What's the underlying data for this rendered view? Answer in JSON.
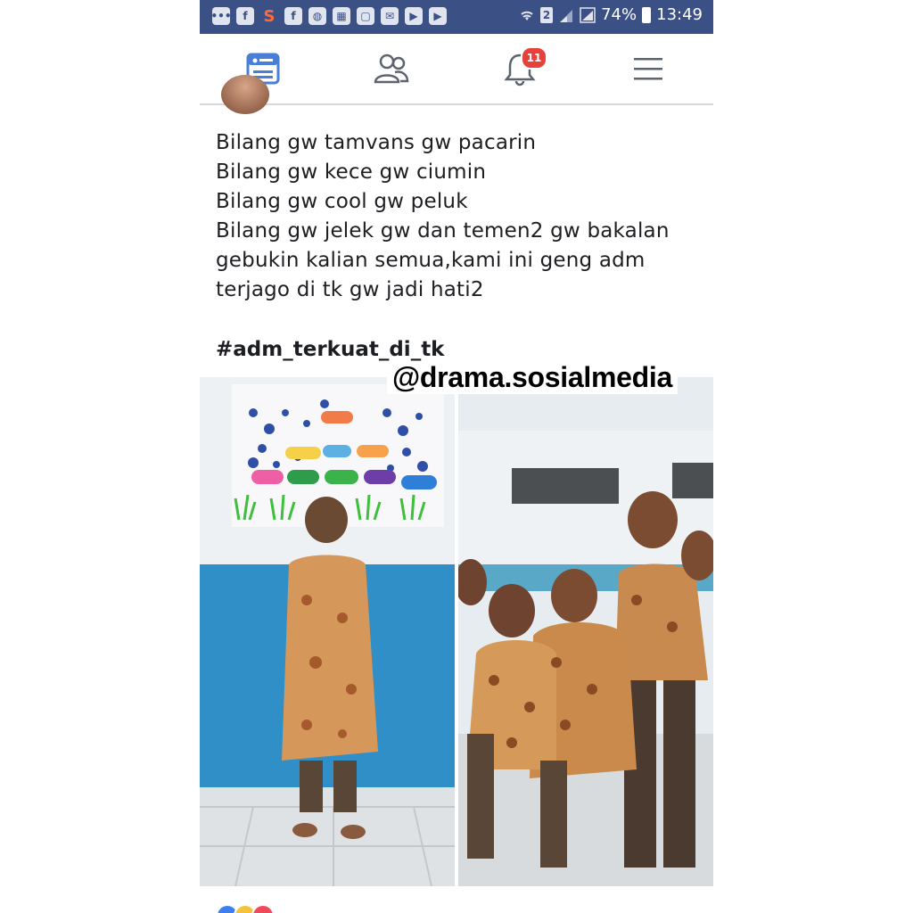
{
  "status_bar": {
    "app_icons": [
      "chat-icon",
      "facebook-icon",
      "s-icon",
      "facebook-icon",
      "line-icon",
      "bbm-icon",
      "file-icon",
      "mail-icon",
      "youtube-icon",
      "youtube-icon"
    ],
    "sim_badge": "2",
    "battery_percent": "74%",
    "time": "13:49"
  },
  "nav": {
    "items": [
      "news-feed-icon",
      "friends-icon",
      "notifications-icon",
      "menu-icon"
    ],
    "notification_count": "11",
    "accent": "#4a7fd8"
  },
  "post": {
    "lines": [
      "Bilang gw tamvans gw pacarin",
      "Bilang gw kece gw ciumin",
      "Bilang gw cool gw peluk",
      "Bilang gw jelek gw dan temen2 gw bakalan",
      "gebukin kalian semua,kami ini geng adm",
      "terjago di tk gw jadi hati2"
    ],
    "hashtag": "#adm_terkuat_di_tk",
    "watermark": "@drama.sosialmedia"
  },
  "colors": {
    "status_bar": "#3b5186",
    "badge": "#e8413b",
    "text": "#1c1e21"
  }
}
